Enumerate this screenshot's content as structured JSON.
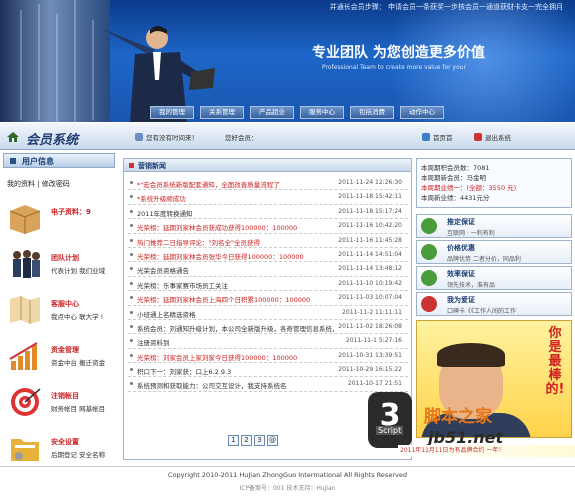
{
  "banner": {
    "slogan_top": "并通长会员步骤： 申请会员一条获奖一步核会员一通道获财卡支一完全拥月",
    "slogan_cn": "专业团队 为您创造更多价值",
    "slogan_en": "Professional Team to create more value for your",
    "nav": [
      "我的管理",
      "关系管理",
      "产品超业",
      "服务中心",
      "包括消费",
      "动作中心"
    ]
  },
  "sysbar": {
    "title": "会员系统",
    "welcome_label": "您有没有时间来！",
    "welcome_label2": "您好会员：",
    "home": "首页首",
    "logout": "退出系统",
    "colors": {
      "home_icon": "#3b7ec9",
      "logout_icon": "#c33"
    }
  },
  "left": {
    "header": "用户信息",
    "links": "我的资料 | 修改密码",
    "sections": [
      {
        "icon": "box-icon",
        "title": "电子资料：9",
        "sub": ""
      },
      {
        "icon": "people-icon",
        "title": "团队计划",
        "sub": "代表计划  我们业域"
      },
      {
        "icon": "map-icon",
        "title": "客服中心",
        "sub": "我点中心  联大学 !"
      },
      {
        "icon": "growth-chart-icon",
        "title": "资金管理",
        "sub": "资金中台  搬迁资金"
      },
      {
        "icon": "target-icon",
        "title": "注销帐目",
        "sub": "财务帐目  网基帐目"
      },
      {
        "icon": "folder-icon",
        "title": "安全设置",
        "sub": "后期登记  安全名称"
      }
    ]
  },
  "news": {
    "header": "营销新闻",
    "items": [
      {
        "text": "*\"宏会员系统新版配套通知，全面改善质量流程了",
        "date": "2011-11-24 12:26:30",
        "red": true
      },
      {
        "text": "*系统升级顺成功",
        "date": "2011-11-18 15:42:11",
        "red": true
      },
      {
        "text": "2011年度转换通知",
        "date": "2011-11-18 15:17:24",
        "red": false
      },
      {
        "text": "光荣榜：延期刘家林会员获成功获得100000：100000",
        "date": "2011-11-16 10:42:20",
        "red": true
      },
      {
        "text": "热门推荐二日指导评论：\"刘名全\"全员获得",
        "date": "2011-11-16 11:45:28",
        "red": true
      },
      {
        "text": "光荣榜：延期刘家林会员张华今日获得100000：100000",
        "date": "2011-11-14 14:51:04",
        "red": true
      },
      {
        "text": "光荣会员资格通告",
        "date": "2011-11-14 13:48:12",
        "red": false
      },
      {
        "text": "光荣榜：乐事家赛市场员工关注",
        "date": "2011-11-10 10:19:42",
        "red": false
      },
      {
        "text": "光荣榜：延期刘家林会员上海四个日积累100000：100000",
        "date": "2011-11-03 10:07:04",
        "red": true
      },
      {
        "text": "小班通上名精选资格",
        "date": "2011-11-2 11:11:11",
        "red": false
      },
      {
        "text": "系统会员：刘通知升级计划，本公司全新版升级，各奇管理信息系统，及时调整所有经营者",
        "date": "2011-11-02 18:26:08",
        "red": false
      },
      {
        "text": "注册资料到",
        "date": "2011-11-1 5:27:16",
        "red": false
      },
      {
        "text": "光荣榜：刘家会员上家刘家今日获得100000：100000",
        "date": "2011-10-31 13:39:51",
        "red": true
      },
      {
        "text": "积口下一：刘家获：口上6.2.9.3",
        "date": "2011-10-29 16:15:22",
        "red": false
      },
      {
        "text": "系统预测和获取能力：公司交互设计，我支持系统名",
        "date": "2011-10-17 21:51",
        "red": false
      }
    ],
    "pages": [
      "1",
      "2",
      "3",
      "@"
    ]
  },
  "stats": {
    "l1": "本周期积会员数：7081",
    "l2": "本周期新会员：马金明",
    "l3": "本周期业绩一：(全额：3550 元)",
    "l4": "本周新业绩：4431元分"
  },
  "right_buttons": [
    {
      "title": "推定保证",
      "sub": "互联网 · 一利有利"
    },
    {
      "title": "价格优惠",
      "sub": "品牌优势 二者分价，同品利"
    },
    {
      "title": "效率保证",
      "sub": "领先技术，准有品"
    },
    {
      "title": "我为爱证",
      "sub": "口碑卡《《工作人间的工作"
    }
  ],
  "ad": {
    "text": "你是最棒的!"
  },
  "ticker": "2011年11月11日为有品牌合约 一年！",
  "watermark": {
    "logo": "3",
    "script": "Script",
    "cn": "脚本之家",
    "url": "jb51.net"
  },
  "footer": {
    "copyright": "Copyright 2010-2011 HuJian ZhongGuo Intermational All Rights Reserved",
    "icp": "ICP备案号：001 技术支持：HuJian"
  }
}
